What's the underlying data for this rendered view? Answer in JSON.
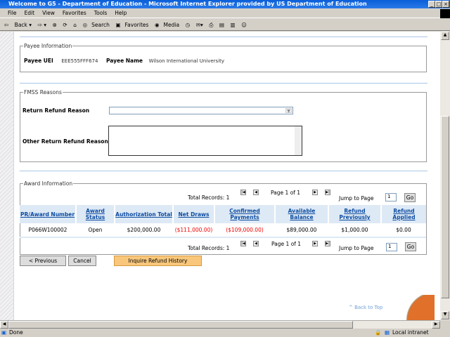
{
  "window": {
    "title": "Welcome to G5 - Department of Education - Microsoft Internet Explorer provided by US Department of Education"
  },
  "menu": [
    "File",
    "Edit",
    "View",
    "Favorites",
    "Tools",
    "Help"
  ],
  "toolbar": {
    "back": "Back",
    "search": "Search",
    "favorites": "Favorites",
    "media": "Media"
  },
  "payee": {
    "legend": "Payee Information",
    "uei_label": "Payee UEI",
    "uei": "EEE555FFF674",
    "name_label": "Payee Name",
    "name": "Wilson International University"
  },
  "fmss": {
    "legend": "FMSS Reasons",
    "reason_label": "Return Refund Reason",
    "reason_value": "",
    "other_label": "Other Return Refund Reason",
    "other_value": ""
  },
  "award": {
    "legend": "Award Information",
    "total_records": "Total Records: 1",
    "page": "Page 1 of 1",
    "jump_label": "Jump to Page",
    "jump_value": "1",
    "go": "Go",
    "columns": [
      "PR/Award Number",
      "Award Status",
      "Authorization Total",
      "Net Draws",
      "Confirmed Payments",
      "Available Balance",
      "Refund Previously",
      "Refund Applied"
    ],
    "rows": [
      [
        "P066W100002",
        "Open",
        "$200,000.00",
        "($111,000.00)",
        "($109,000.00)",
        "$89,000.00",
        "$1,000.00",
        "$0.00"
      ]
    ]
  },
  "buttons": {
    "previous": "< Previous",
    "cancel": "Cancel",
    "inquire": "Inquire Refund History"
  },
  "back_to_top": "^ Back to Top",
  "status": {
    "text": "Done",
    "zone": "Local intranet"
  },
  "colors": {
    "link": "#0d4ca1",
    "negative": "#e00000",
    "accent_button": "#f8c77c"
  }
}
